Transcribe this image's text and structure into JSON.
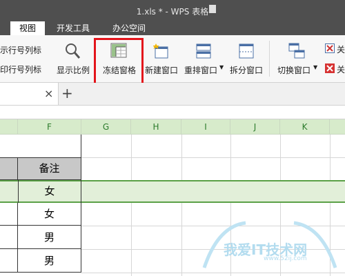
{
  "window": {
    "title": "1.xls * - WPS 表格"
  },
  "tabs": [
    "视图",
    "开发工具",
    "办公空间"
  ],
  "ribbon": {
    "show_row_col_label": "示行号列标",
    "print_row_col_label": "印行号列标",
    "zoom_label": "显示比例",
    "freeze_label": "冻结窗格",
    "new_window_label": "新建窗口",
    "arrange_label": "重排窗口",
    "split_label": "拆分窗口",
    "switch_label": "切换窗口",
    "close_label_1": "关",
    "close_label_2": "关"
  },
  "doc_tabs": {
    "close_glyph": "×",
    "add_glyph": "+"
  },
  "sheet": {
    "columns": [
      "F",
      "G",
      "H",
      "I",
      "J",
      "K"
    ],
    "header_cells": [
      "备注"
    ],
    "rows": [
      "女",
      "女",
      "男",
      "男"
    ],
    "partial_left_glyphs": [
      "",
      "",
      "",
      "",
      ""
    ]
  },
  "watermark": {
    "text": "我爱IT技术网",
    "url": "www.52ij.com"
  },
  "colors": {
    "title_bg": "#4f4f4f",
    "ribbon_bg": "#f7f7f7",
    "highlight": "#e3141b",
    "selected_row": "#e2efd9",
    "header_green": "#d7ebcb"
  }
}
